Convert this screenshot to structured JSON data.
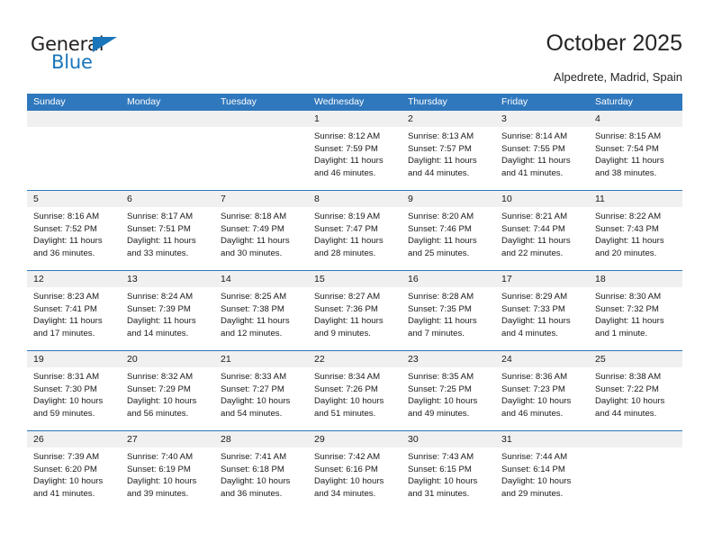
{
  "brand": {
    "word1": "General",
    "word2": "Blue",
    "triangle_color": "#1a75bb"
  },
  "header": {
    "title": "October 2025",
    "location": "Alpedrete, Madrid, Spain",
    "accent_color": "#3078bd",
    "band_color": "#f0f0f0"
  },
  "weekday_headers": [
    "Sunday",
    "Monday",
    "Tuesday",
    "Wednesday",
    "Thursday",
    "Friday",
    "Saturday"
  ],
  "weeks": [
    [
      {
        "day": "",
        "lines": []
      },
      {
        "day": "",
        "lines": []
      },
      {
        "day": "",
        "lines": []
      },
      {
        "day": "1",
        "lines": [
          "Sunrise: 8:12 AM",
          "Sunset: 7:59 PM",
          "Daylight: 11 hours",
          "and 46 minutes."
        ]
      },
      {
        "day": "2",
        "lines": [
          "Sunrise: 8:13 AM",
          "Sunset: 7:57 PM",
          "Daylight: 11 hours",
          "and 44 minutes."
        ]
      },
      {
        "day": "3",
        "lines": [
          "Sunrise: 8:14 AM",
          "Sunset: 7:55 PM",
          "Daylight: 11 hours",
          "and 41 minutes."
        ]
      },
      {
        "day": "4",
        "lines": [
          "Sunrise: 8:15 AM",
          "Sunset: 7:54 PM",
          "Daylight: 11 hours",
          "and 38 minutes."
        ]
      }
    ],
    [
      {
        "day": "5",
        "lines": [
          "Sunrise: 8:16 AM",
          "Sunset: 7:52 PM",
          "Daylight: 11 hours",
          "and 36 minutes."
        ]
      },
      {
        "day": "6",
        "lines": [
          "Sunrise: 8:17 AM",
          "Sunset: 7:51 PM",
          "Daylight: 11 hours",
          "and 33 minutes."
        ]
      },
      {
        "day": "7",
        "lines": [
          "Sunrise: 8:18 AM",
          "Sunset: 7:49 PM",
          "Daylight: 11 hours",
          "and 30 minutes."
        ]
      },
      {
        "day": "8",
        "lines": [
          "Sunrise: 8:19 AM",
          "Sunset: 7:47 PM",
          "Daylight: 11 hours",
          "and 28 minutes."
        ]
      },
      {
        "day": "9",
        "lines": [
          "Sunrise: 8:20 AM",
          "Sunset: 7:46 PM",
          "Daylight: 11 hours",
          "and 25 minutes."
        ]
      },
      {
        "day": "10",
        "lines": [
          "Sunrise: 8:21 AM",
          "Sunset: 7:44 PM",
          "Daylight: 11 hours",
          "and 22 minutes."
        ]
      },
      {
        "day": "11",
        "lines": [
          "Sunrise: 8:22 AM",
          "Sunset: 7:43 PM",
          "Daylight: 11 hours",
          "and 20 minutes."
        ]
      }
    ],
    [
      {
        "day": "12",
        "lines": [
          "Sunrise: 8:23 AM",
          "Sunset: 7:41 PM",
          "Daylight: 11 hours",
          "and 17 minutes."
        ]
      },
      {
        "day": "13",
        "lines": [
          "Sunrise: 8:24 AM",
          "Sunset: 7:39 PM",
          "Daylight: 11 hours",
          "and 14 minutes."
        ]
      },
      {
        "day": "14",
        "lines": [
          "Sunrise: 8:25 AM",
          "Sunset: 7:38 PM",
          "Daylight: 11 hours",
          "and 12 minutes."
        ]
      },
      {
        "day": "15",
        "lines": [
          "Sunrise: 8:27 AM",
          "Sunset: 7:36 PM",
          "Daylight: 11 hours",
          "and 9 minutes."
        ]
      },
      {
        "day": "16",
        "lines": [
          "Sunrise: 8:28 AM",
          "Sunset: 7:35 PM",
          "Daylight: 11 hours",
          "and 7 minutes."
        ]
      },
      {
        "day": "17",
        "lines": [
          "Sunrise: 8:29 AM",
          "Sunset: 7:33 PM",
          "Daylight: 11 hours",
          "and 4 minutes."
        ]
      },
      {
        "day": "18",
        "lines": [
          "Sunrise: 8:30 AM",
          "Sunset: 7:32 PM",
          "Daylight: 11 hours",
          "and 1 minute."
        ]
      }
    ],
    [
      {
        "day": "19",
        "lines": [
          "Sunrise: 8:31 AM",
          "Sunset: 7:30 PM",
          "Daylight: 10 hours",
          "and 59 minutes."
        ]
      },
      {
        "day": "20",
        "lines": [
          "Sunrise: 8:32 AM",
          "Sunset: 7:29 PM",
          "Daylight: 10 hours",
          "and 56 minutes."
        ]
      },
      {
        "day": "21",
        "lines": [
          "Sunrise: 8:33 AM",
          "Sunset: 7:27 PM",
          "Daylight: 10 hours",
          "and 54 minutes."
        ]
      },
      {
        "day": "22",
        "lines": [
          "Sunrise: 8:34 AM",
          "Sunset: 7:26 PM",
          "Daylight: 10 hours",
          "and 51 minutes."
        ]
      },
      {
        "day": "23",
        "lines": [
          "Sunrise: 8:35 AM",
          "Sunset: 7:25 PM",
          "Daylight: 10 hours",
          "and 49 minutes."
        ]
      },
      {
        "day": "24",
        "lines": [
          "Sunrise: 8:36 AM",
          "Sunset: 7:23 PM",
          "Daylight: 10 hours",
          "and 46 minutes."
        ]
      },
      {
        "day": "25",
        "lines": [
          "Sunrise: 8:38 AM",
          "Sunset: 7:22 PM",
          "Daylight: 10 hours",
          "and 44 minutes."
        ]
      }
    ],
    [
      {
        "day": "26",
        "lines": [
          "Sunrise: 7:39 AM",
          "Sunset: 6:20 PM",
          "Daylight: 10 hours",
          "and 41 minutes."
        ]
      },
      {
        "day": "27",
        "lines": [
          "Sunrise: 7:40 AM",
          "Sunset: 6:19 PM",
          "Daylight: 10 hours",
          "and 39 minutes."
        ]
      },
      {
        "day": "28",
        "lines": [
          "Sunrise: 7:41 AM",
          "Sunset: 6:18 PM",
          "Daylight: 10 hours",
          "and 36 minutes."
        ]
      },
      {
        "day": "29",
        "lines": [
          "Sunrise: 7:42 AM",
          "Sunset: 6:16 PM",
          "Daylight: 10 hours",
          "and 34 minutes."
        ]
      },
      {
        "day": "30",
        "lines": [
          "Sunrise: 7:43 AM",
          "Sunset: 6:15 PM",
          "Daylight: 10 hours",
          "and 31 minutes."
        ]
      },
      {
        "day": "31",
        "lines": [
          "Sunrise: 7:44 AM",
          "Sunset: 6:14 PM",
          "Daylight: 10 hours",
          "and 29 minutes."
        ]
      },
      {
        "day": "",
        "lines": []
      }
    ]
  ]
}
